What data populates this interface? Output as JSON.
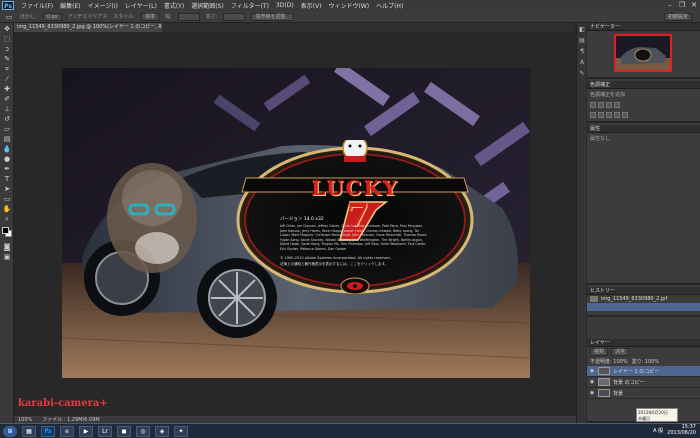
{
  "app": {
    "logo": "Ps"
  },
  "menubar": {
    "items": [
      "ファイル(F)",
      "編集(E)",
      "イメージ(I)",
      "レイヤー(L)",
      "書式(Y)",
      "選択範囲(S)",
      "フィルター(T)",
      "3D(D)",
      "表示(V)",
      "ウィンドウ(W)",
      "ヘルプ(H)"
    ],
    "minimize": "–",
    "restore": "❐",
    "close": "✕"
  },
  "options": {
    "feather_label": "ぼかし:",
    "feather_value": "0 px",
    "antialias": "アンチエイリアス",
    "style_label": "スタイル:",
    "style_value": "標準",
    "width_label": "幅:",
    "height_label": "高さ:",
    "refine": "境界線を調整...",
    "workspace": "初期設定"
  },
  "document": {
    "tab_title": "img_11549_6330980_2.jpg @ 100%(レイヤー 1 のコピー, RGB/8)"
  },
  "status": {
    "zoom": "100%",
    "info": "ファイル : 1.29M/6.09M"
  },
  "about": {
    "brand": "LUCKY",
    "number": "7",
    "version": "バージョン 14.0 x32",
    "credits": "Jeff Chien, Jon Clauson, Jeffrey Cohen, Chris Cox, Alan Erickson, Pete Falco, Paul Ferguson, John Hanson, Jerry Harris, Kevin Hopps, Joseph Hsieh, Chintan Intwala, Betty Leong, Tai Luxon, Mark Maguire, Christoph Moskalonek, John Peterson, Dave Polaschek, Thomas Ruark, Yuyan Song, Sarah Stuckey, Nikolai Svakhin, John Worthington, Tim Wright, Barkin Aygun, David Howe, Sarah Kong, Yinglan Ma, Tom Pinkerton, Jeff Sass, Yukie Takahashi, Tina Carter, Eric Snyder, Rebecca Gomes, Dan Gerber",
    "copyright": "© 1990-2012 Adobe Systems Incorporated. All rights reserved.",
    "notice": "法律上の通知と著作権表示を表示するには、ここをクリックします。"
  },
  "panels": {
    "navigator": {
      "title": "ナビゲーター"
    },
    "adjustments": {
      "title": "色調補正",
      "subtitle": "色調補正を追加"
    },
    "properties": {
      "title": "属性",
      "subtitle": "属性なし"
    },
    "history": {
      "title": "ヒストリー",
      "snapshot": "img_11549_6330980_2.jpf"
    },
    "layers": {
      "title": "レイヤー",
      "filter": "種類",
      "blend": "通常",
      "opacity": "不透明度: 100%",
      "fill": "塗り: 100%",
      "rows": [
        {
          "name": "レイヤー 1 のコピー",
          "selected": true
        },
        {
          "name": "背景 のコピー",
          "selected": false
        },
        {
          "name": "背景",
          "selected": false
        }
      ]
    }
  },
  "taskbar": {
    "start": "⊞",
    "lang": "A 般",
    "time": "15:37",
    "date1": "2013/06/20",
    "weekday": "木曜日",
    "tooltip": "2013年6月20日"
  },
  "watermark": "karabi-camera+"
}
